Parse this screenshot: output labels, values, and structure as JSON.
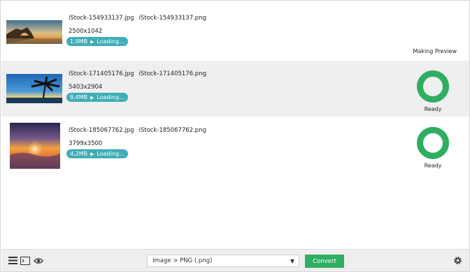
{
  "files": [
    {
      "source_name": "iStock-154933137.jpg",
      "target_name": "iStock-154933137.png",
      "dimensions": "2500x1042",
      "size": "1,9MB",
      "loading": "Loading...",
      "status": "Making Preview",
      "thumb": "coastal-arch-sunset"
    },
    {
      "source_name": "iStock-171405176.jpg",
      "target_name": "iStock-171405176.png",
      "dimensions": "5403x2904",
      "size": "8,4MB",
      "loading": "Loading...",
      "status": "Ready",
      "thumb": "palm-tree-sunset"
    },
    {
      "source_name": "iStock-185067762.jpg",
      "target_name": "iStock-185067762.png",
      "dimensions": "3799x3500",
      "size": "4,2MB",
      "loading": "Loading...",
      "status": "Ready",
      "thumb": "sunrise-over-clouds"
    }
  ],
  "toolbar": {
    "format_select": "Image > PNG (.png)",
    "convert_label": "Convert",
    "icons": [
      "menu-icon",
      "terminal-icon",
      "eye-icon",
      "gear-icon"
    ]
  },
  "colors": {
    "accent_teal": "#3daeb6",
    "ready_green": "#2fae61",
    "row_alt": "#efefef"
  }
}
